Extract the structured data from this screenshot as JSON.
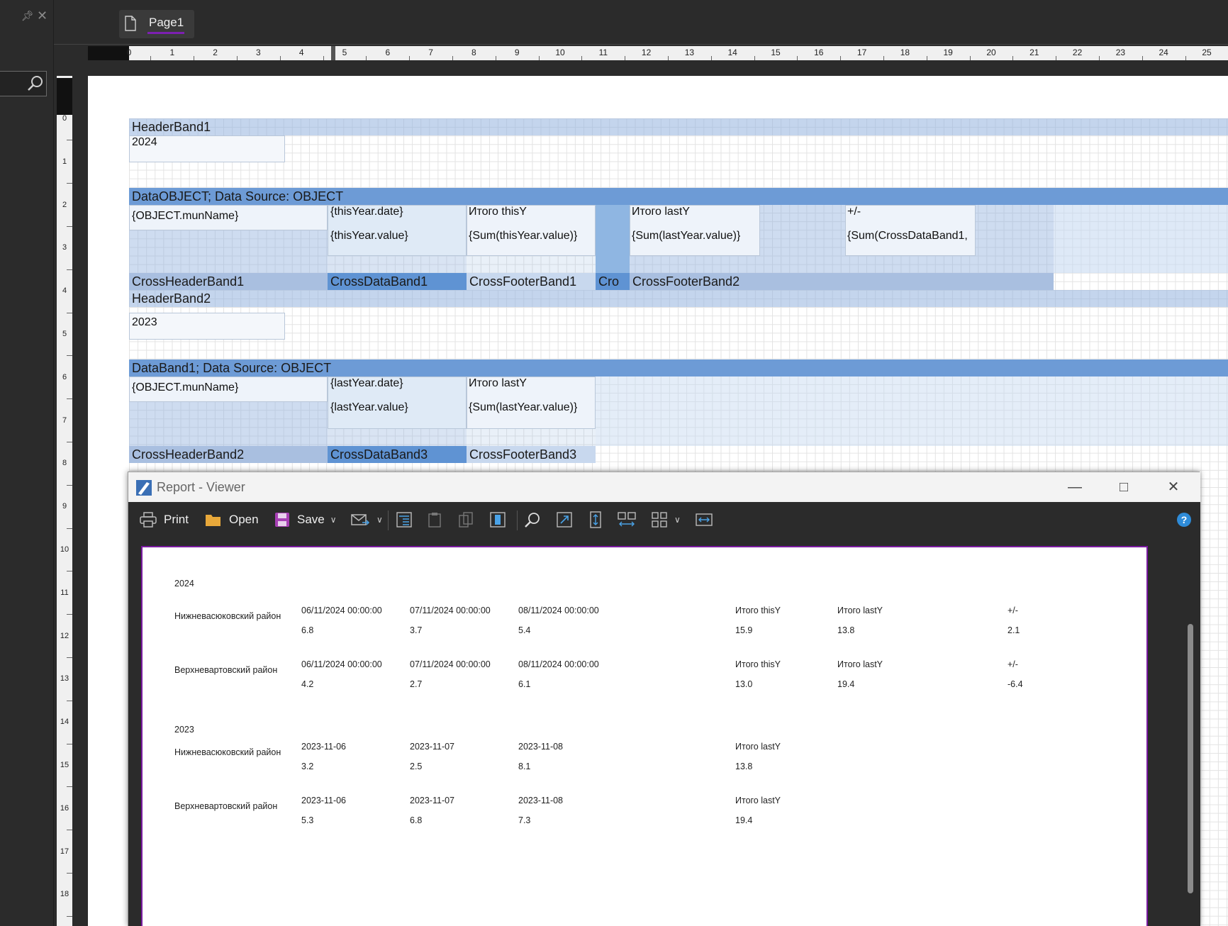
{
  "tab": {
    "label": "Page1"
  },
  "ruler": {
    "h": [
      "0",
      "1",
      "2",
      "3",
      "4",
      "5",
      "6",
      "7",
      "8",
      "9",
      "10",
      "11",
      "12",
      "13",
      "14",
      "15",
      "16",
      "17",
      "18",
      "19",
      "20",
      "21",
      "22",
      "23",
      "24",
      "25"
    ],
    "v": [
      "0",
      "1",
      "2",
      "3",
      "4",
      "5",
      "6",
      "7",
      "8",
      "9",
      "10",
      "11",
      "12",
      "13",
      "14",
      "15",
      "16",
      "17",
      "18"
    ]
  },
  "design": {
    "header1": "HeaderBand1",
    "year1": "2024",
    "data_object": "DataOBJECT; Data Source: OBJECT",
    "munname1": "{OBJECT.munName}",
    "this_date": "{thisYear.date}",
    "this_value": "{thisYear.value}",
    "itogo_this": "Итого thisY",
    "sum_this": "{Sum(thisYear.value)}",
    "itogo_last_1": "Итого lastY",
    "sum_last_1": "{Sum(lastYear.value)}",
    "plusminus": "+/-",
    "sum_cross": "{Sum(CrossDataBand1,",
    "cross_header1": "CrossHeaderBand1",
    "cross_data1": "CrossDataBand1",
    "cross_footer1": "CrossFooterBand1",
    "cro": "Cro",
    "cross_footer2": "CrossFooterBand2",
    "header2": "HeaderBand2",
    "year2": "2023",
    "databand1": "DataBand1; Data Source: OBJECT",
    "munname2": "{OBJECT.munName}",
    "last_date": "{lastYear.date}",
    "last_value": "{lastYear.value}",
    "itogo_last_2": "Итого lastY",
    "sum_last_2": "{Sum(lastYear.value)}",
    "cross_header2": "CrossHeaderBand2",
    "cross_data3": "CrossDataBand3",
    "cross_footer3": "CrossFooterBand3"
  },
  "viewer": {
    "title": "Report - Viewer",
    "toolbar": {
      "print": "Print",
      "open": "Open",
      "save": "Save"
    },
    "report": {
      "year1": "2024",
      "rows2024": [
        {
          "name": "Нижневасюковский район",
          "dates": [
            "06/11/2024 00:00:00",
            "07/11/2024 00:00:00",
            "08/11/2024 00:00:00"
          ],
          "values": [
            "6.8",
            "3.7",
            "5.4"
          ],
          "itogo_this_label": "Итого thisY",
          "itogo_this": "15.9",
          "itogo_last_label": "Итого lastY",
          "itogo_last": "13.8",
          "diff_label": "+/-",
          "diff": "2.1"
        },
        {
          "name": "Верхневартовский район",
          "dates": [
            "06/11/2024 00:00:00",
            "07/11/2024 00:00:00",
            "08/11/2024 00:00:00"
          ],
          "values": [
            "4.2",
            "2.7",
            "6.1"
          ],
          "itogo_this_label": "Итого thisY",
          "itogo_this": "13.0",
          "itogo_last_label": "Итого lastY",
          "itogo_last": "19.4",
          "diff_label": "+/-",
          "diff": "-6.4"
        }
      ],
      "year2": "2023",
      "rows2023": [
        {
          "name": "Нижневасюковский район",
          "dates": [
            "2023-11-06",
            "2023-11-07",
            "2023-11-08"
          ],
          "values": [
            "3.2",
            "2.5",
            "8.1"
          ],
          "itogo_label": "Итого lastY",
          "itogo": "13.8"
        },
        {
          "name": "Верхневартовский район",
          "dates": [
            "2023-11-06",
            "2023-11-07",
            "2023-11-08"
          ],
          "values": [
            "5.3",
            "6.8",
            "7.3"
          ],
          "itogo_label": "Итого lastY",
          "itogo": "19.4"
        }
      ]
    }
  }
}
